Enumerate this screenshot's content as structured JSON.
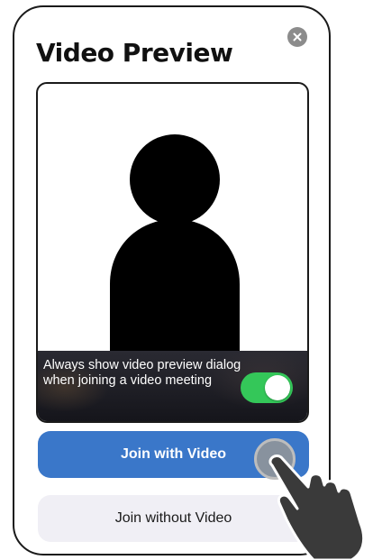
{
  "dialog": {
    "title": "Video Preview",
    "close_icon": "close-icon"
  },
  "preview": {
    "silhouette_icon": "person-silhouette",
    "always_show_label": "Always show video preview dialog when joining a video meeting",
    "toggle_on": true
  },
  "buttons": {
    "join_with_video": "Join with Video",
    "join_without_video": "Join without Video"
  },
  "colors": {
    "primary_button": "#3a77c9",
    "secondary_button": "#f0eff5",
    "toggle_on": "#34c759",
    "close_button": "#8c8c8c"
  }
}
